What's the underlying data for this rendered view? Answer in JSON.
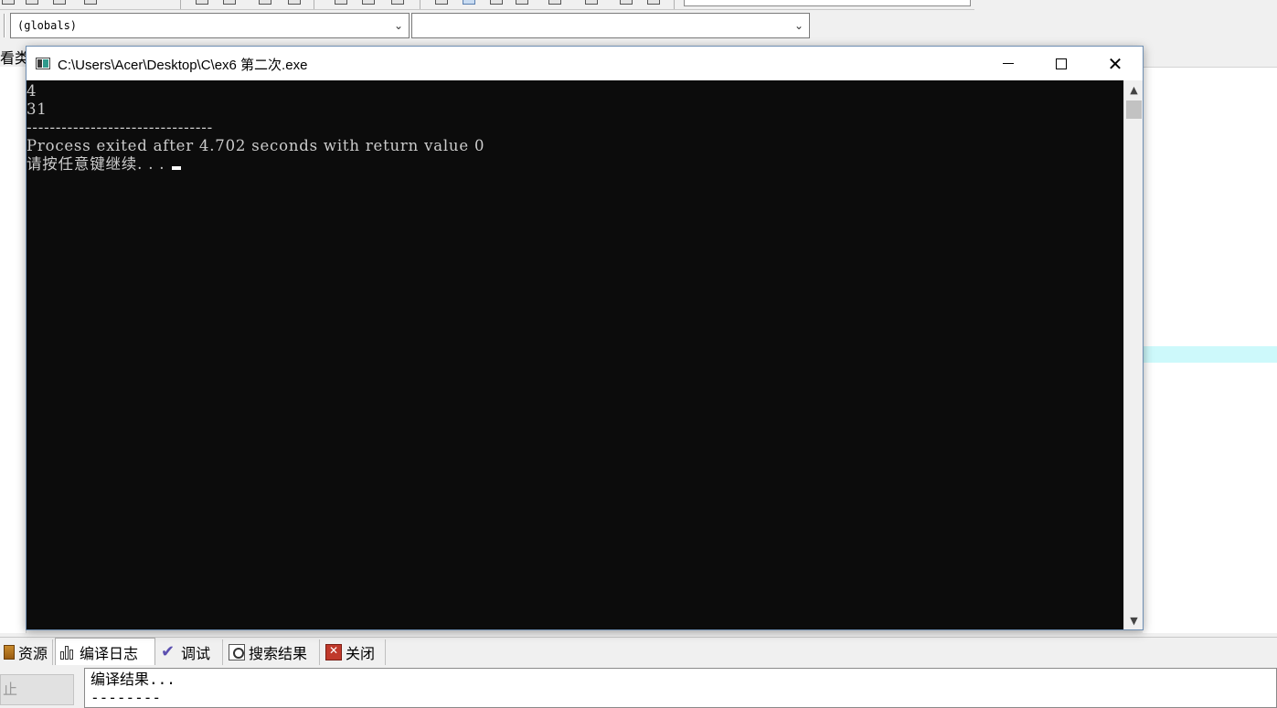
{
  "ide": {
    "globals_combo": "(globals)",
    "member_combo": "",
    "left_tab_text": "看类",
    "bottom_tabs": [
      {
        "label": "资源",
        "icon": "resource-icon"
      },
      {
        "label": "编译日志",
        "icon": "bar-chart-icon"
      },
      {
        "label": "调试",
        "icon": "debug-check-icon"
      },
      {
        "label": "搜索结果",
        "icon": "search-results-icon"
      },
      {
        "label": "关闭",
        "icon": "close-panel-icon"
      }
    ],
    "bottom_button_label": "止",
    "compile_output": "编译结果...\n--------\n- 错误"
  },
  "console": {
    "title": "C:\\Users\\Acer\\Desktop\\C\\ex6 第二次.exe",
    "lines": [
      "4",
      "31",
      "--------------------------------",
      "Process exited after 4.702 seconds with return value 0",
      "请按任意键继续. . . "
    ],
    "buttons": {
      "minimize": "minimize-icon",
      "maximize": "maximize-icon",
      "close": "close-icon"
    }
  },
  "colors": {
    "console_bg": "#0c0c0c",
    "console_fg": "#cccccc",
    "highlight_line": "#cdf9fb"
  }
}
